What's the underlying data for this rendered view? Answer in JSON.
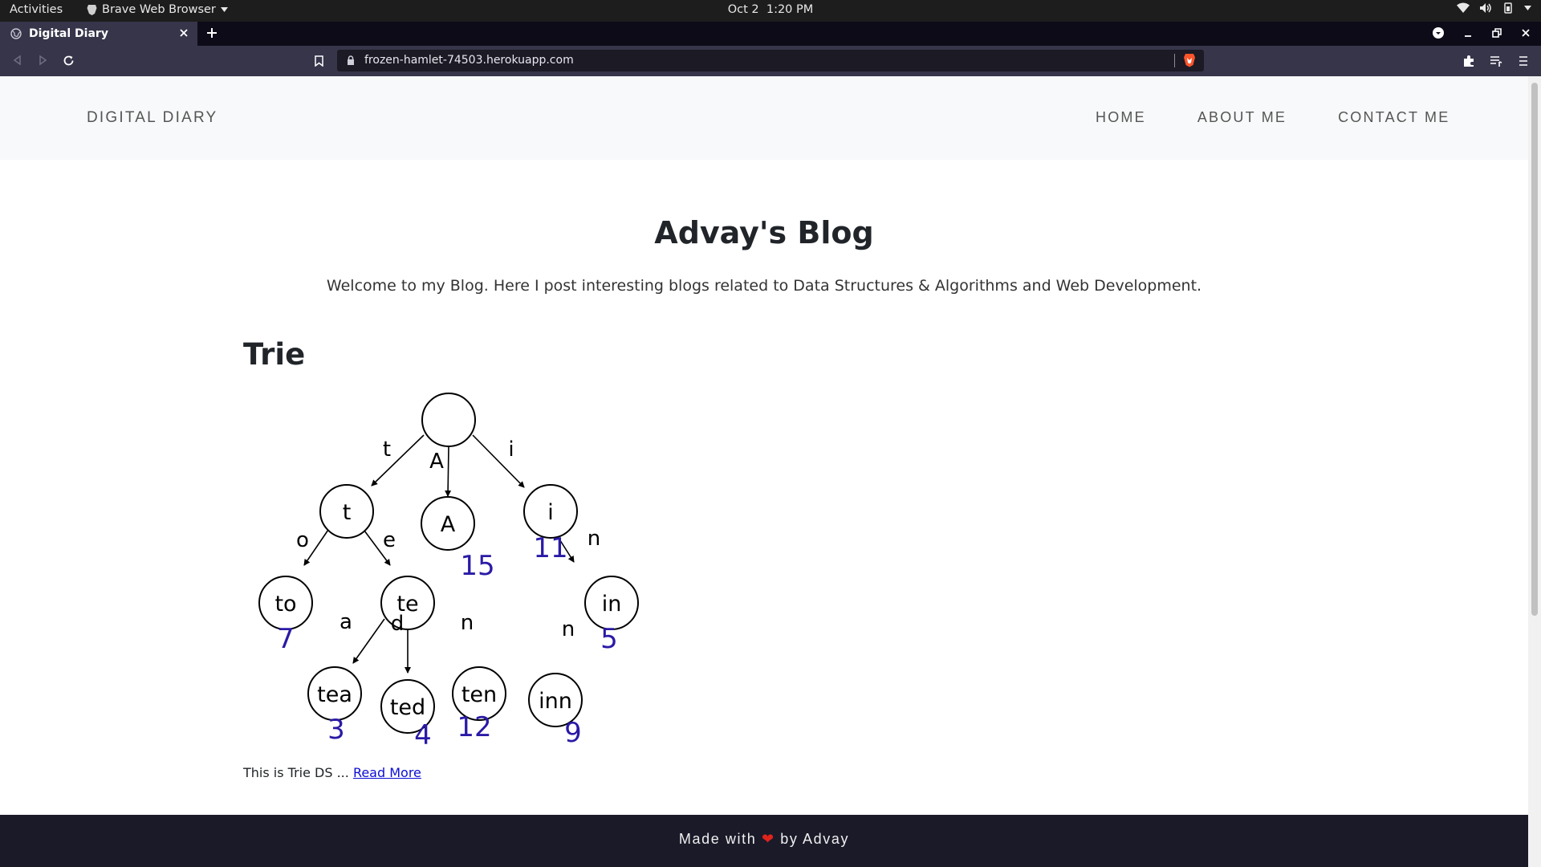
{
  "os_bar": {
    "activities": "Activities",
    "app_name": "Brave Web Browser",
    "date": "Oct 2",
    "time": "1:20 PM"
  },
  "browser": {
    "tab_title": "Digital Diary",
    "url": "frozen-hamlet-74503.herokuapp.com"
  },
  "site": {
    "brand": "DIGITAL DIARY",
    "nav": [
      "HOME",
      "ABOUT ME",
      "CONTACT ME"
    ],
    "heading": "Advay's Blog",
    "subheading": "Welcome to my Blog. Here I post interesting blogs related to Data Structures & Algorithms and Web Development.",
    "post": {
      "title": "Trie",
      "excerpt": "This is Trie DS ...",
      "read_more": "Read More"
    },
    "footer": {
      "prefix": "Made with",
      "heart": "❤",
      "suffix": "by Advay"
    }
  },
  "trie_diagram": {
    "nodes": [
      {
        "label": "",
        "count": ""
      },
      {
        "label": "t",
        "count": ""
      },
      {
        "label": "A",
        "count": "15"
      },
      {
        "label": "i",
        "count": "11"
      },
      {
        "label": "to",
        "count": "7"
      },
      {
        "label": "te",
        "count": ""
      },
      {
        "label": "in",
        "count": "5"
      },
      {
        "label": "tea",
        "count": "3"
      },
      {
        "label": "ted",
        "count": "4"
      },
      {
        "label": "ten",
        "count": "12"
      },
      {
        "label": "inn",
        "count": "9"
      }
    ],
    "edge_labels": [
      "t",
      "A",
      "i",
      "o",
      "e",
      "n",
      "a",
      "d",
      "n",
      "n"
    ],
    "colors": {
      "count": "#2a1aa6",
      "stroke": "#000000"
    }
  },
  "colors": {
    "footer_bg": "#1b1a29",
    "navbar_bg": "#f8f9fa",
    "browser_chrome": "#36354a",
    "heart": "#e0241b"
  }
}
